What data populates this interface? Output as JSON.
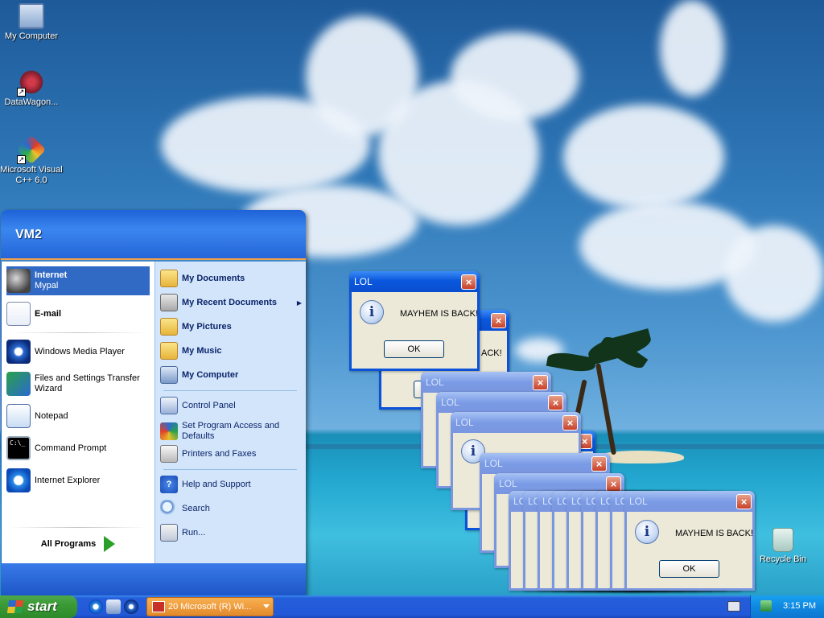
{
  "desktop": {
    "icons": [
      {
        "label": "My Computer",
        "icon": "my-computer-icon"
      },
      {
        "label": "DataWagon...",
        "icon": "datawagon-icon"
      },
      {
        "label": "Microsoft Visual C++ 6.0",
        "icon": "visual-cpp-icon"
      },
      {
        "label": "Recycle Bin",
        "icon": "recycle-bin-icon"
      }
    ]
  },
  "start_menu": {
    "user": "VM2",
    "pinned": [
      {
        "title": "Internet",
        "subtitle": "Mypal",
        "icon": "mypal-icon"
      },
      {
        "title": "E-mail",
        "subtitle": "",
        "icon": "email-icon"
      }
    ],
    "recent": [
      {
        "label": "Windows Media Player",
        "icon": "media-player-icon"
      },
      {
        "label": "Files and Settings Transfer Wizard",
        "icon": "transfer-wizard-icon"
      },
      {
        "label": "Notepad",
        "icon": "notepad-icon"
      },
      {
        "label": "Command Prompt",
        "icon": "command-prompt-icon"
      },
      {
        "label": "Internet Explorer",
        "icon": "internet-explorer-icon"
      }
    ],
    "all_programs": "All Programs",
    "places": [
      {
        "label": "My Documents",
        "icon": "folder-icon"
      },
      {
        "label": "My Recent Documents",
        "icon": "recent-documents-icon"
      },
      {
        "label": "My Pictures",
        "icon": "folder-icon"
      },
      {
        "label": "My Music",
        "icon": "folder-icon"
      },
      {
        "label": "My Computer",
        "icon": "computer-icon"
      }
    ],
    "settings": [
      {
        "label": "Control Panel",
        "icon": "control-panel-icon"
      },
      {
        "label": "Set Program Access and Defaults",
        "icon": "program-access-icon"
      },
      {
        "label": "Printers and Faxes",
        "icon": "printer-icon"
      }
    ],
    "tools": [
      {
        "label": "Help and Support",
        "icon": "help-icon"
      },
      {
        "label": "Search",
        "icon": "search-icon"
      },
      {
        "label": "Run...",
        "icon": "run-icon"
      }
    ]
  },
  "dialog": {
    "title": "LOL",
    "message": "MAYHEM IS BACK!",
    "ok_label": "OK",
    "partial_message": "ACK!",
    "close_glyph": "×"
  },
  "taskbar": {
    "start_label": "start",
    "task_label": "20 Microsoft (R) Wi...",
    "clock": "3:15 PM"
  },
  "colors": {
    "taskbar_blue": "#245edb",
    "start_green": "#3a9a36",
    "title_active": "#0a58de",
    "title_inactive": "#7a96df",
    "task_orange": "#e38a2a"
  }
}
